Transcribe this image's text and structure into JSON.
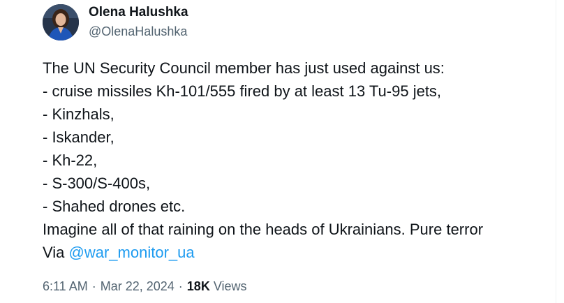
{
  "author": {
    "display_name": "Olena Halushka",
    "handle": "@OlenaHalushka",
    "avatar_icon": "profile-photo"
  },
  "tweet": {
    "lines": [
      "The UN Security Council member has just used against us:",
      "- cruise missiles Kh-101/555 fired by at least 13 Tu-95 jets,",
      "- Kinzhals,",
      "- Iskander,",
      "- Kh-22,",
      "- S-300/S-400s,",
      "- Shahed drones etc.",
      "Imagine all of that raining on the heads of Ukrainians. Pure terror"
    ],
    "via_prefix": "Via ",
    "via_mention": "@war_monitor_ua"
  },
  "meta": {
    "time": "6:11 AM",
    "separator": "·",
    "date": "Mar 22, 2024",
    "views_count": "18K",
    "views_label": "Views"
  },
  "colors": {
    "text": "#0f1419",
    "secondary": "#536471",
    "link": "#1d9bf0"
  }
}
